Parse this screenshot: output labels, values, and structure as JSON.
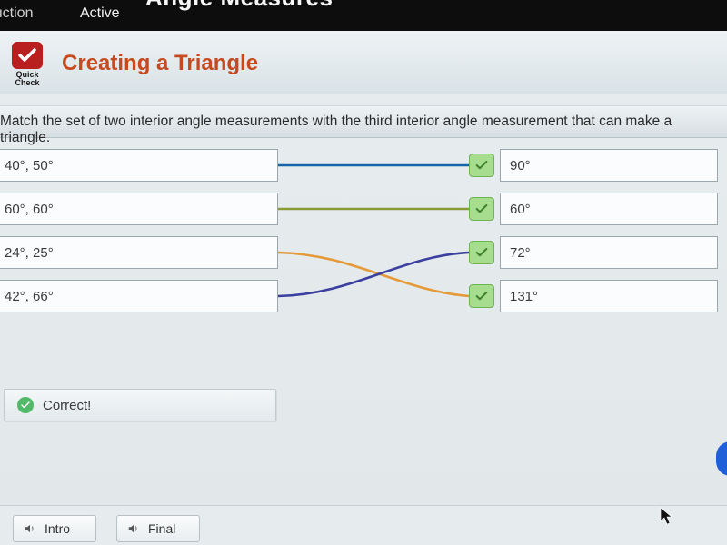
{
  "crumbs": {
    "left": "truction",
    "right": "Active",
    "partial_title": "Angle Measures"
  },
  "quickcheck": {
    "line1": "Quick",
    "line2": "Check"
  },
  "title": "Creating a Triangle",
  "instruction": "Match the set of two interior angle measurements with the third interior angle measurement that can make a triangle.",
  "left": [
    "40°, 50°",
    "60°, 60°",
    "24°, 25°",
    "42°, 66°"
  ],
  "right": [
    "90°",
    "60°",
    "72°",
    "131°"
  ],
  "connections": [
    {
      "from": 0,
      "to": 0,
      "color": "blue"
    },
    {
      "from": 1,
      "to": 1,
      "color": "olive"
    },
    {
      "from": 2,
      "to": 3,
      "color": "orange"
    },
    {
      "from": 3,
      "to": 2,
      "color": "indigo"
    }
  ],
  "feedback": "Correct!",
  "audio": {
    "intro": "Intro",
    "final": "Final"
  },
  "colors": {
    "accent": "#c64a20",
    "correct": "#53b96a"
  }
}
